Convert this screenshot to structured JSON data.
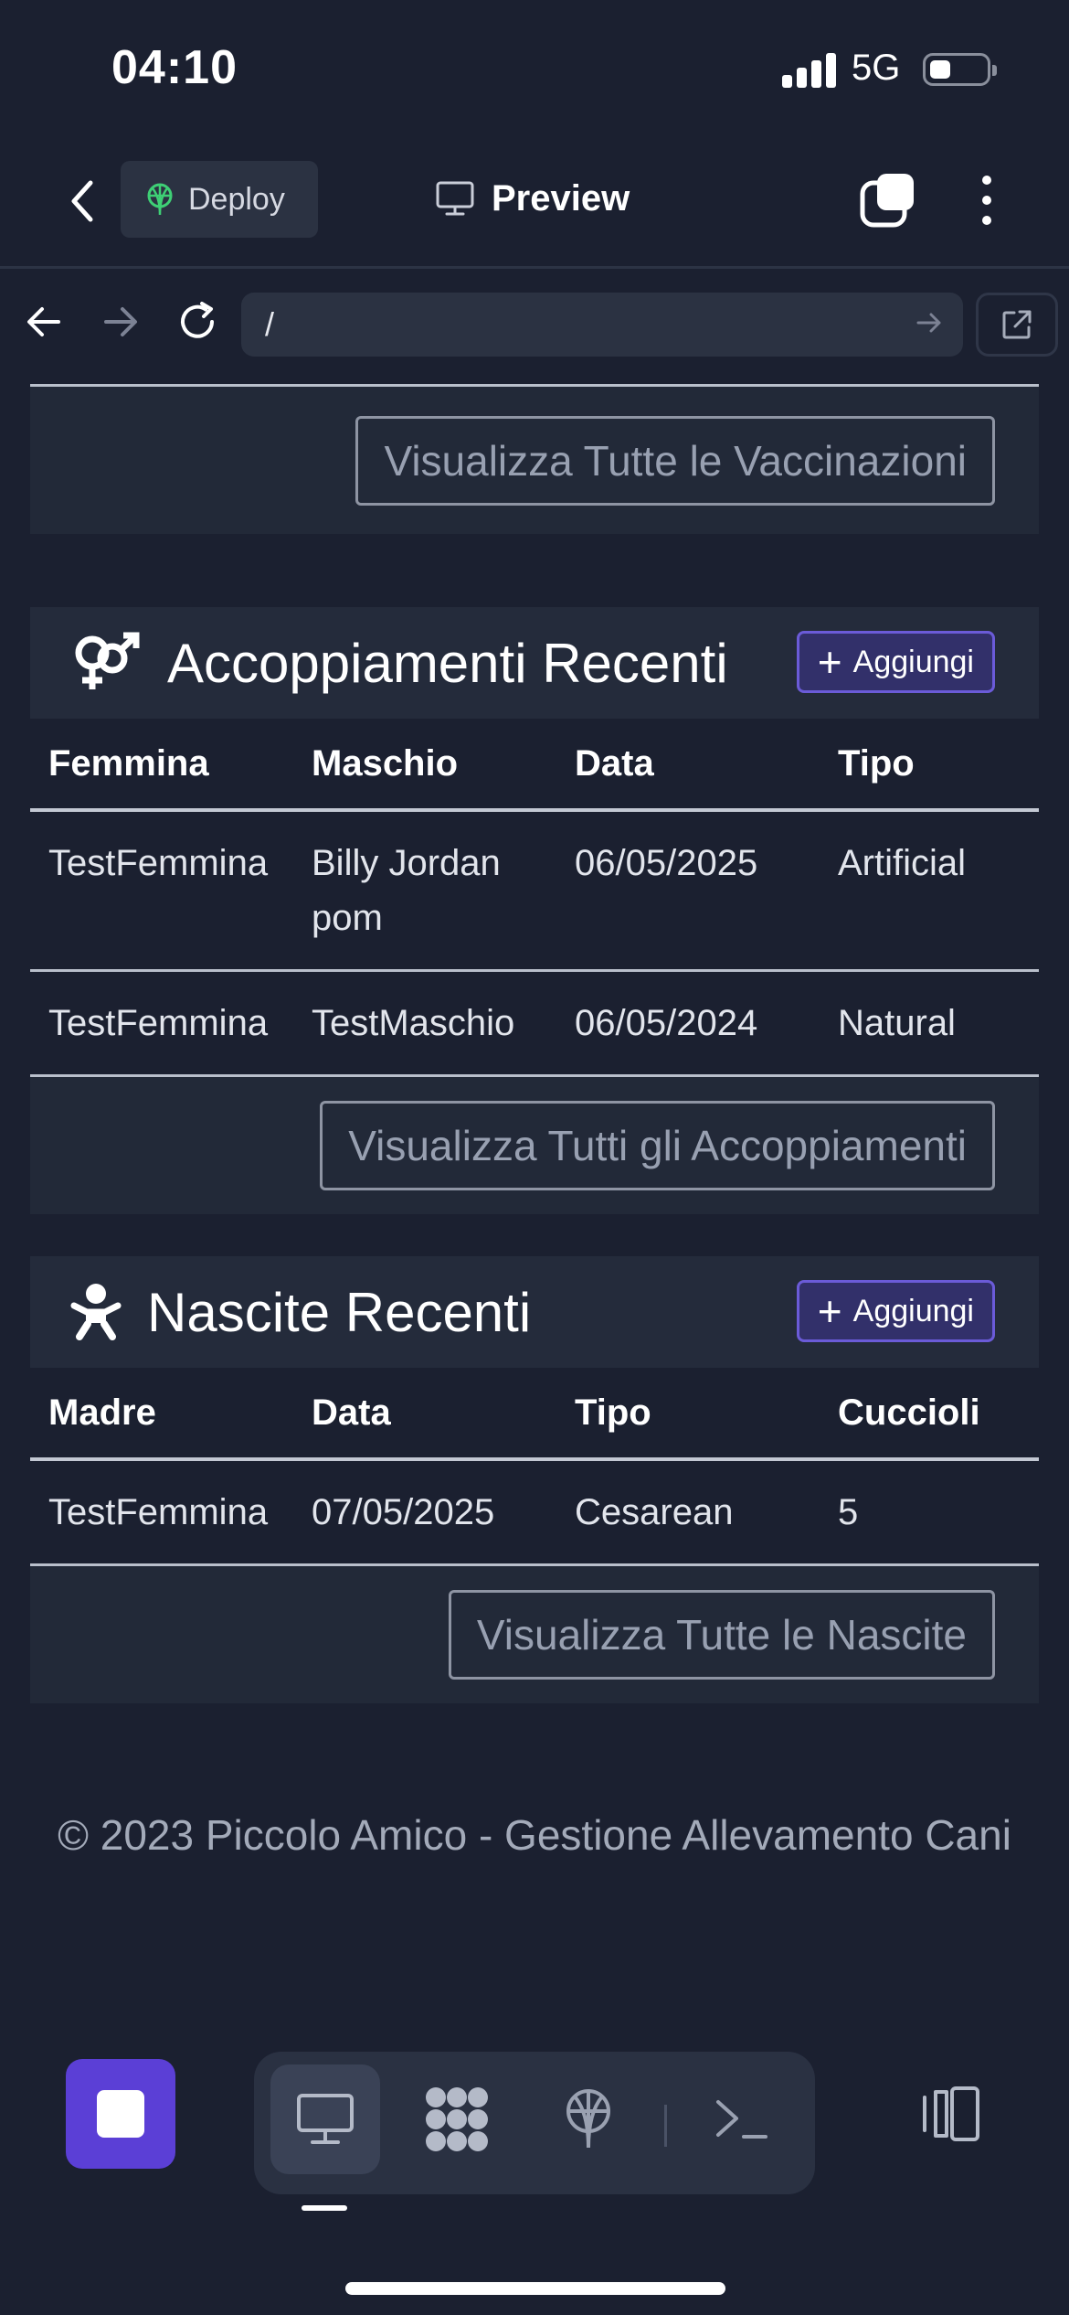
{
  "status_bar": {
    "time": "04:10",
    "network": "5G",
    "battery_level": 0.35
  },
  "header": {
    "back_icon": "chevron-left-icon",
    "deploy_label": "Deploy",
    "deploy_icon": "deploy-icon",
    "preview_label": "Preview",
    "preview_icon": "monitor-icon",
    "tabs_icon": "tabs-icon",
    "more_icon": "more-vertical-icon"
  },
  "browser": {
    "url": "/"
  },
  "vaccinations_card": {
    "view_all_label": "Visualizza Tutte le Vaccinazioni"
  },
  "matings_card": {
    "title": "Accoppiamenti Recenti",
    "icon": "gender-symbols-icon",
    "add_label": "Aggiungi",
    "columns": [
      "Femmina",
      "Maschio",
      "Data",
      "Tipo"
    ],
    "rows": [
      [
        "TestFemmina",
        "Billy Jordan pom",
        "06/05/2025",
        "Artificial"
      ],
      [
        "TestFemmina",
        "TestMaschio",
        "06/05/2024",
        "Natural"
      ]
    ],
    "view_all_label": "Visualizza Tutti gli Accoppiamenti"
  },
  "births_card": {
    "title": "Nascite Recenti",
    "icon": "baby-icon",
    "add_label": "Aggiungi",
    "columns": [
      "Madre",
      "Data",
      "Tipo",
      "Cuccioli"
    ],
    "rows": [
      [
        "TestFemmina",
        "07/05/2025",
        "Cesarean",
        "5"
      ]
    ],
    "view_all_label": "Visualizza Tutte le Nascite"
  },
  "footer": {
    "text": "© 2023 Piccolo Amico - Gestione Allevamento Cani"
  },
  "toolbar": {
    "stop_icon": "stop-icon",
    "tools": [
      "monitor-icon",
      "apps-icon",
      "deploy-icon",
      "terminal-icon"
    ],
    "active_tool": "monitor-icon",
    "panel_icon": "panel-toggle-icon"
  },
  "colors": {
    "background": "#1b2030",
    "accent": "#5b3fd6",
    "card": "#222938"
  }
}
